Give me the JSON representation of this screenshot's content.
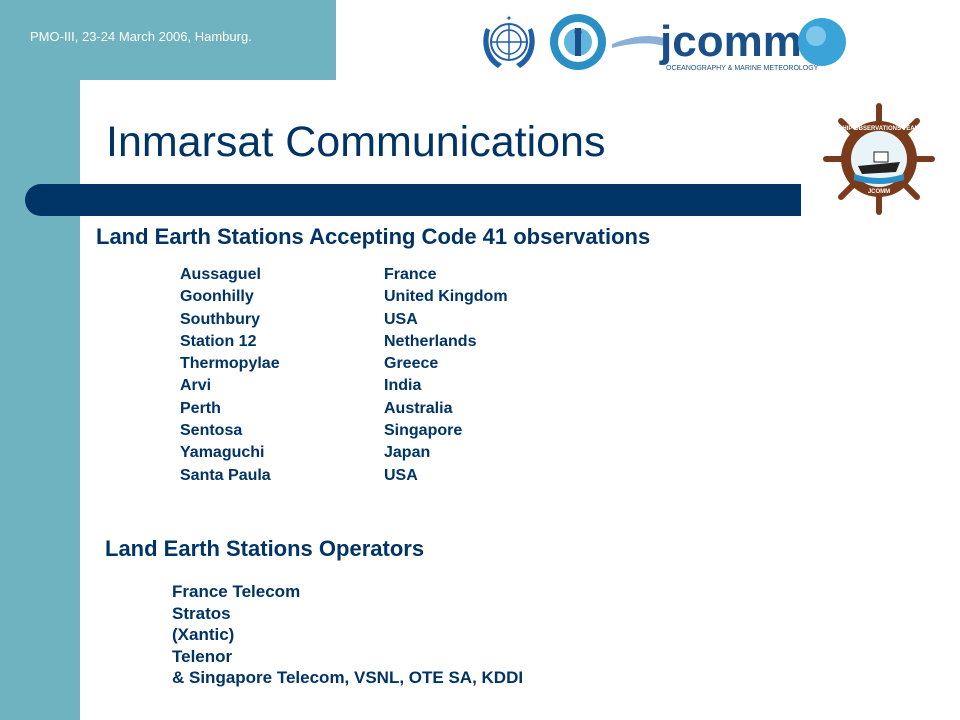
{
  "header": {
    "text": "PMO-III, 23-24 March 2006, Hamburg."
  },
  "title": "Inmarsat Communications",
  "section1": {
    "heading": "Land Earth Stations Accepting Code 41 observations",
    "stations": [
      {
        "name": "Aussaguel",
        "country": "France"
      },
      {
        "name": "Goonhilly",
        "country": "United Kingdom"
      },
      {
        "name": "Southbury",
        "country": "USA"
      },
      {
        "name": "Station 12",
        "country": "Netherlands"
      },
      {
        "name": "Thermopylae",
        "country": "Greece"
      },
      {
        "name": "Arvi",
        "country": "India"
      },
      {
        "name": "Perth",
        "country": "Australia"
      },
      {
        "name": "Sentosa",
        "country": "Singapore"
      },
      {
        "name": "Yamaguchi",
        "country": "Japan"
      },
      {
        "name": "Santa Paula",
        "country": "USA"
      }
    ]
  },
  "section2": {
    "heading": "Land Earth Stations Operators",
    "operators": [
      "France Telecom",
      "Stratos",
      "(Xantic)",
      "Telenor",
      "& Singapore Telecom, VSNL, OTE SA, KDDI"
    ]
  },
  "logos": {
    "jcomm_text": "jcomm",
    "jcomm_tagline": "OCEANOGRAPHY & MARINE METEOROLOGY",
    "sot_top": "SHIP OBSERVATIONS TEAM",
    "sot_bottom": "JCOMM"
  },
  "colors": {
    "teal": "#6fb3c0",
    "navy": "#003366",
    "white": "#ffffff"
  }
}
